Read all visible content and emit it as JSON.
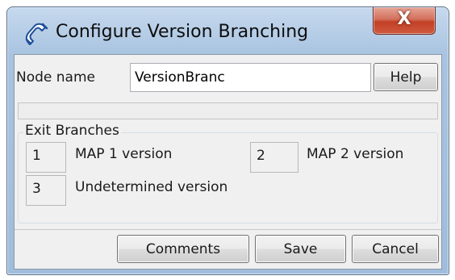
{
  "window": {
    "title": "Configure Version Branching",
    "close_label": "X",
    "app_icon": "phone-handset-icon"
  },
  "node": {
    "label": "Node name",
    "value": "VersionBranc"
  },
  "help_button": "Help",
  "exit_branches": {
    "legend": "Exit Branches",
    "items": [
      {
        "number": "1",
        "label": "MAP 1 version"
      },
      {
        "number": "2",
        "label": "MAP 2 version"
      },
      {
        "number": "3",
        "label": "Undetermined version"
      }
    ]
  },
  "buttons": {
    "comments": "Comments",
    "save": "Save",
    "cancel": "Cancel"
  }
}
